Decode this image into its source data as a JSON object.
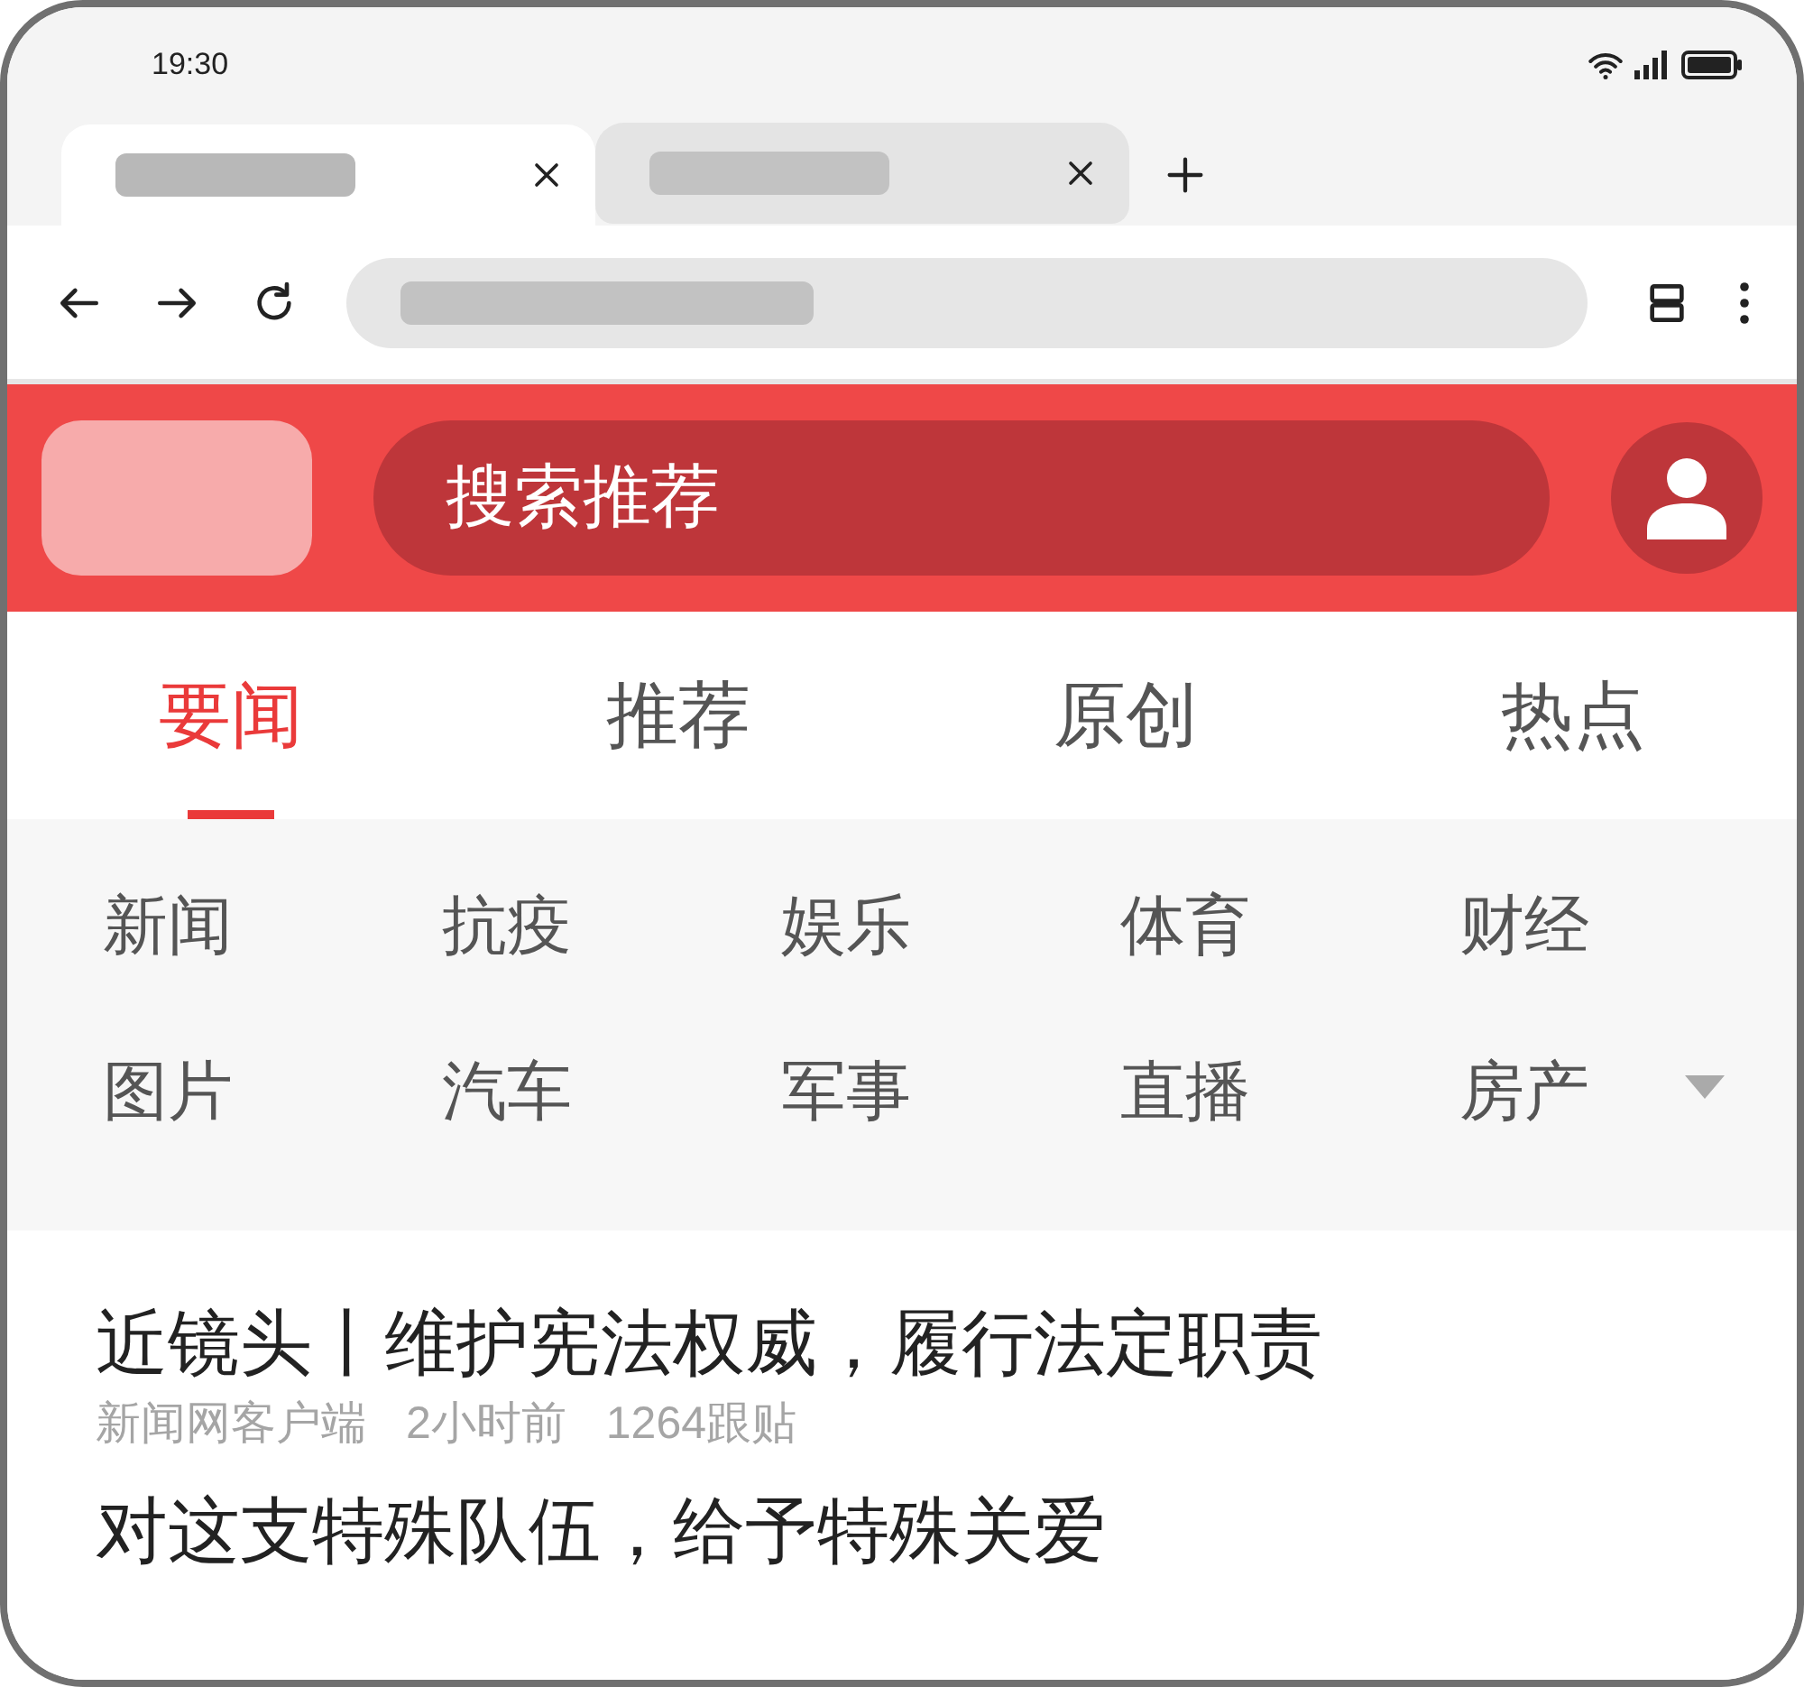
{
  "status_bar": {
    "time": "19:30"
  },
  "browser_tabs": [
    {
      "selected": true
    },
    {
      "selected": false
    }
  ],
  "header": {
    "search_placeholder": "搜索推荐"
  },
  "channel_tabs": [
    {
      "label": "要闻",
      "selected": true
    },
    {
      "label": "推荐",
      "selected": false
    },
    {
      "label": "原创",
      "selected": false
    },
    {
      "label": "热点",
      "selected": false
    }
  ],
  "categories": [
    "新闻",
    "抗疫",
    "娱乐",
    "体育",
    "财经",
    "图片",
    "汽车",
    "军事",
    "直播",
    "房产"
  ],
  "news": [
    {
      "title": "近镜头丨维护宪法权威，履行法定职责",
      "source": "新闻网客户端",
      "time": "2小时前",
      "comments": "1264跟贴"
    },
    {
      "title": "对这支特殊队伍，给予特殊关爱"
    }
  ]
}
